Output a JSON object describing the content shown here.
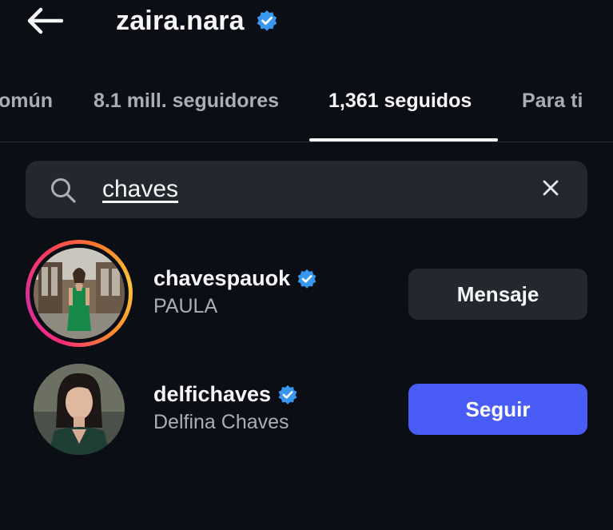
{
  "header": {
    "back_icon": "arrow-left-icon",
    "title": "zaira.nara",
    "verified_icon": "verified-badge-icon",
    "accent_color": "#3897f0"
  },
  "tabs": [
    {
      "label": "omún",
      "active": false
    },
    {
      "label": "8.1 mill. seguidores",
      "active": false
    },
    {
      "label": "1,361 seguidos",
      "active": true
    },
    {
      "label": "Para ti",
      "active": false
    }
  ],
  "search": {
    "icon": "search-icon",
    "value": "chaves",
    "clear_icon": "close-icon"
  },
  "results": [
    {
      "username": "chavespauok",
      "full_name": "PAULA",
      "verified": true,
      "has_story": true,
      "button_label": "Mensaje"
    },
    {
      "username": "delfichaves",
      "full_name": "Delfina Chaves",
      "verified": true,
      "has_story": false,
      "button_label": "Seguir"
    }
  ],
  "colors": {
    "background": "#0b0f15",
    "surface": "#23272e",
    "follow_button": "#4a5cf7",
    "secondary_text": "#a9adb5"
  }
}
